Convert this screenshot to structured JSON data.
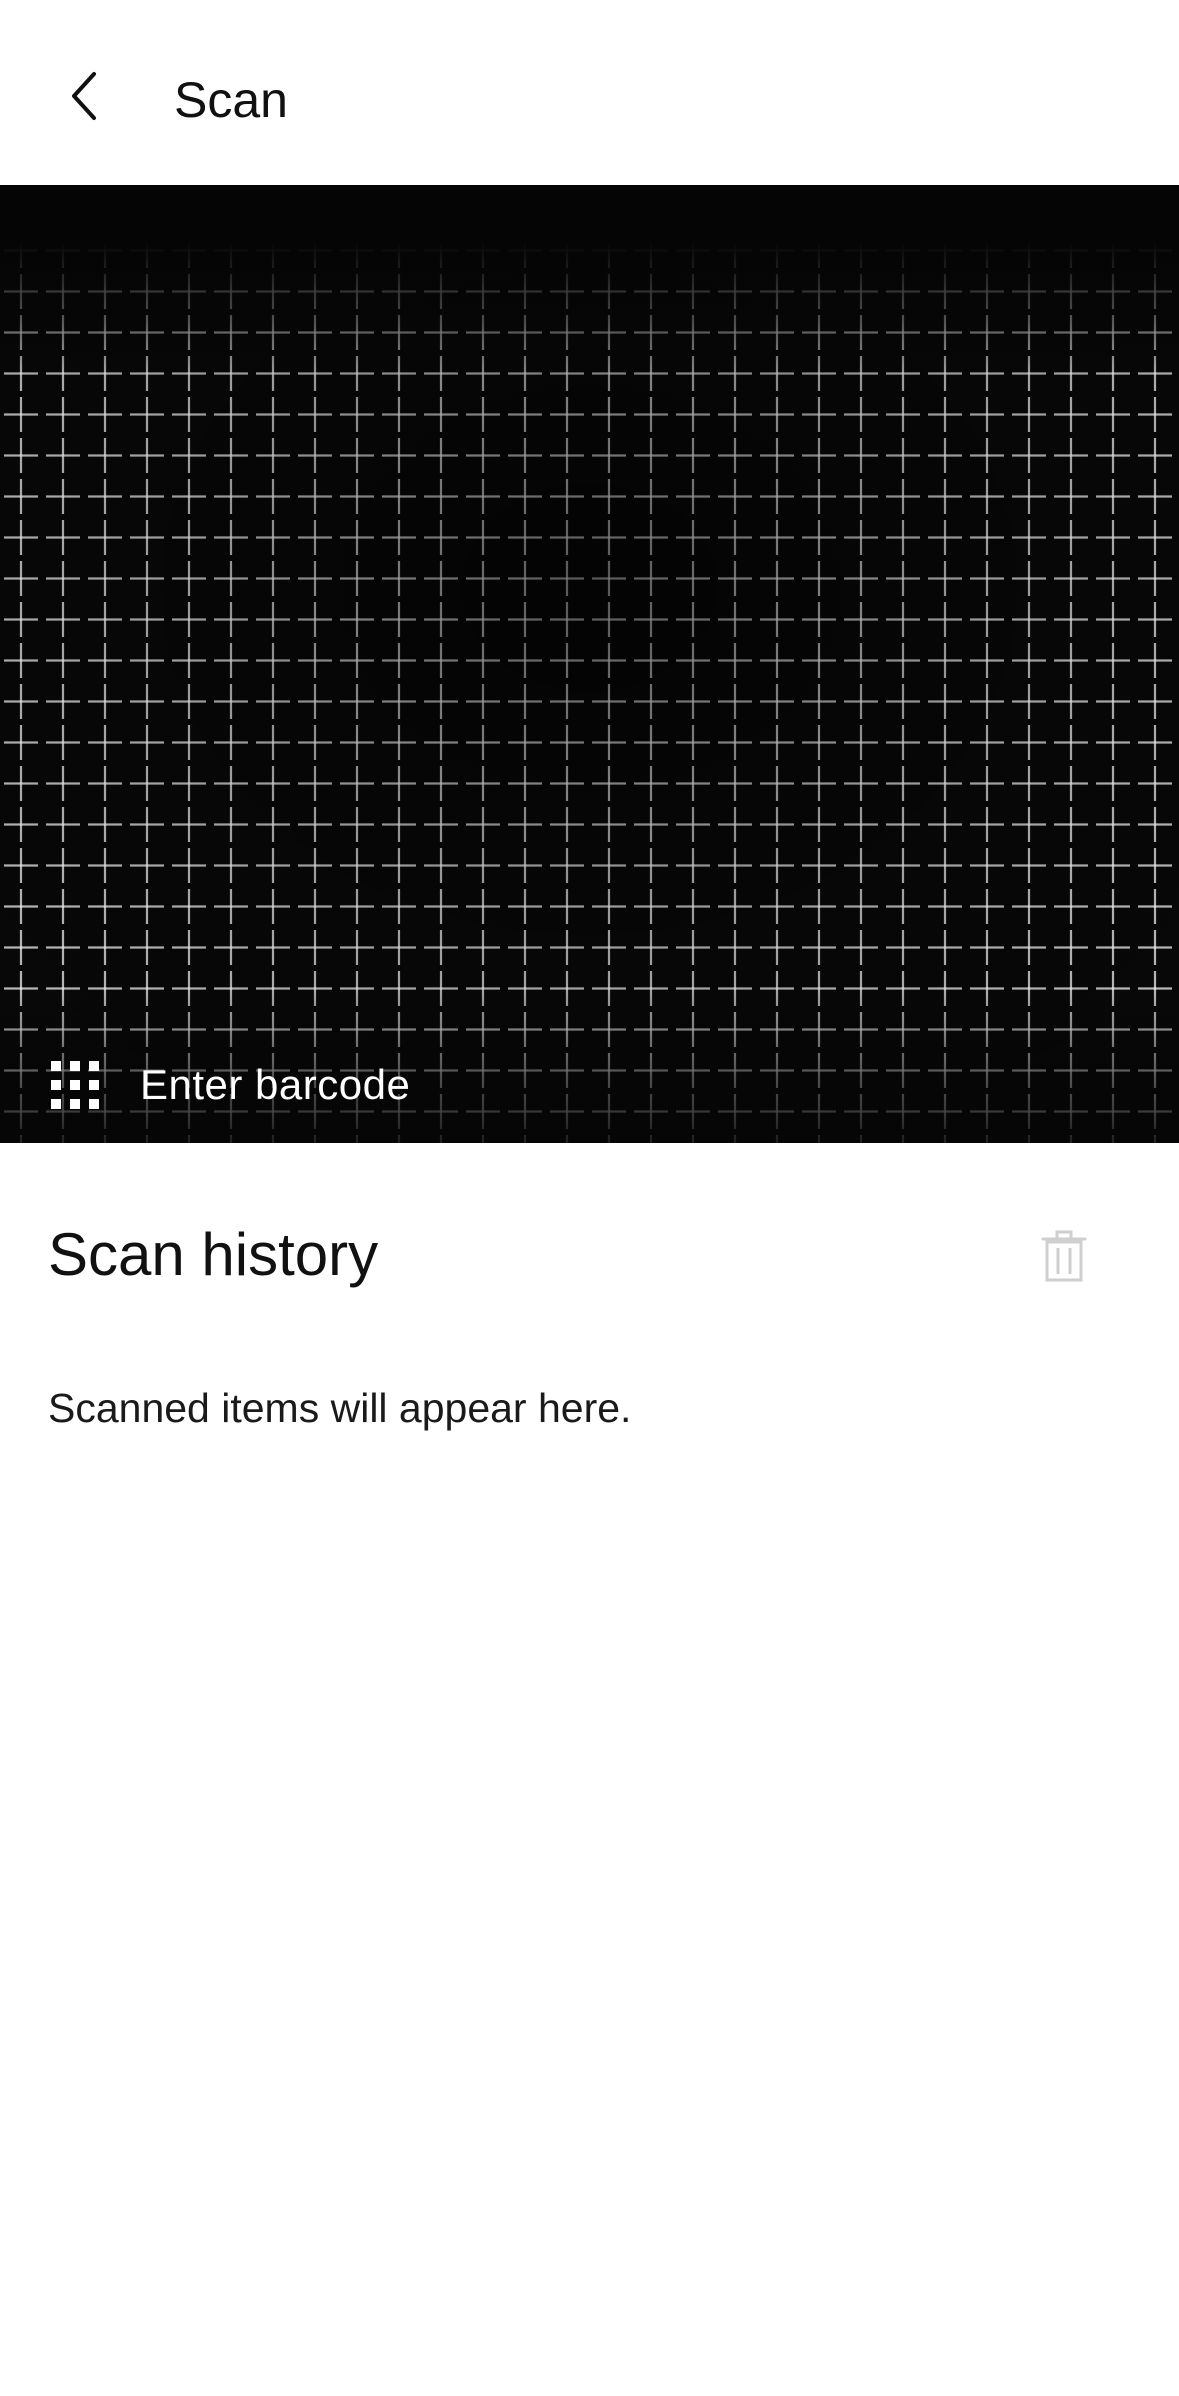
{
  "header": {
    "title": "Scan",
    "back_icon": "chevron-left-icon"
  },
  "scanner": {
    "enter_barcode_label": "Enter barcode",
    "keypad_icon": "keypad-icon"
  },
  "history": {
    "title": "Scan history",
    "empty_message": "Scanned items will appear here.",
    "clear_icon": "trash-icon"
  },
  "colors": {
    "background": "#ffffff",
    "viewfinder": "#050505",
    "text": "#111111",
    "disabled_icon": "#cccccc"
  }
}
